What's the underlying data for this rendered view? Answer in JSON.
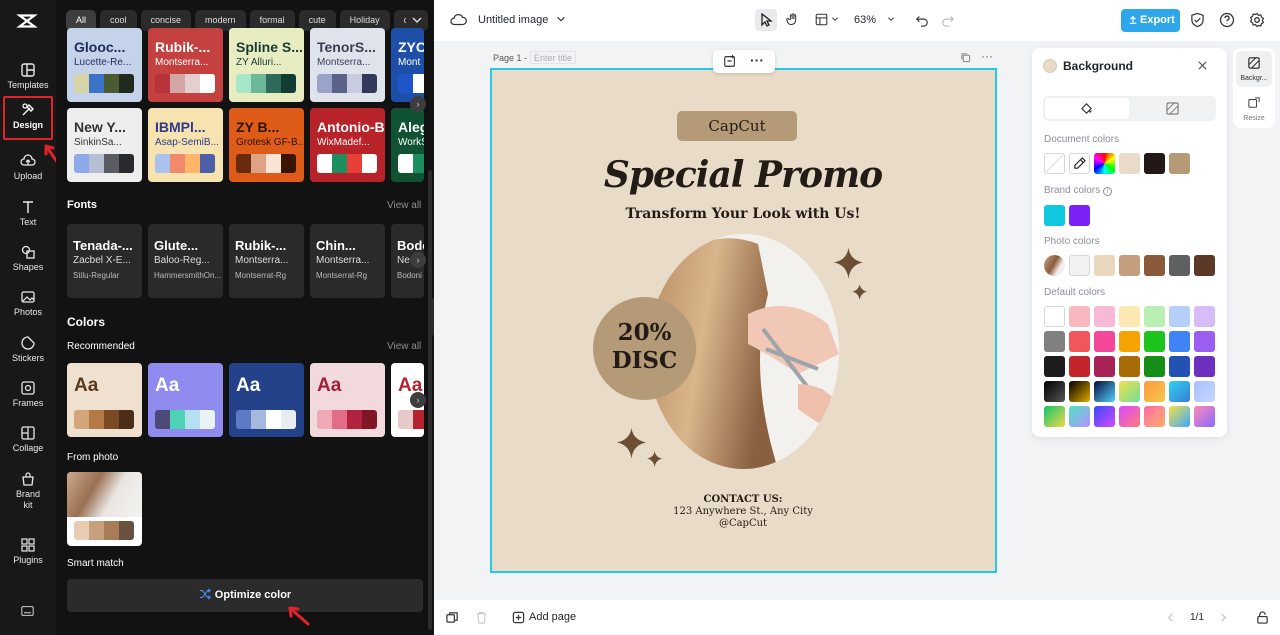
{
  "rail": {
    "items": [
      {
        "label": "Templates"
      },
      {
        "label": "Design"
      },
      {
        "label": "Upload"
      },
      {
        "label": "Text"
      },
      {
        "label": "Shapes"
      },
      {
        "label": "Photos"
      },
      {
        "label": "Stickers"
      },
      {
        "label": "Frames"
      },
      {
        "label": "Collage"
      },
      {
        "label": "Brand kit"
      },
      {
        "label": "Plugins"
      }
    ]
  },
  "chips": [
    "All",
    "cool",
    "concise",
    "modern",
    "formal",
    "cute",
    "Holiday",
    "clas"
  ],
  "font_pairs": [
    {
      "f1": "Glooc...",
      "f2": "Lucette-Re...",
      "bg": "#c5d3ea",
      "color": "#1c2d5a"
    },
    {
      "f1": "Rubik-...",
      "f2": "Montserra...",
      "bg": "#c5413f",
      "color": "#ffffff"
    },
    {
      "f1": "Spline S...",
      "f2": "ZY Alluri...",
      "bg": "#e8ecc1",
      "color": "#173b33"
    },
    {
      "f1": "TenorS...",
      "f2": "Montserra...",
      "bg": "#dfe3ec",
      "color": "#3a3f55"
    },
    {
      "f1": "ZYC",
      "f2": "Mont",
      "bg": "#1e4fa8",
      "color": "#ffffff"
    },
    {
      "f1": "New Y...",
      "f2": "SinkinSa...",
      "bg": "#eeeeee",
      "color": "#333333"
    },
    {
      "f1": "IBMPl...",
      "f2": "Asap-SemiB...",
      "bg": "#f6e3b0",
      "color": "#2f3a8a"
    },
    {
      "f1": "ZY B...",
      "f2": "Grotesk GF-B...",
      "bg": "#de5b18",
      "color": "#2a1406"
    },
    {
      "f1": "Antonio-Bold",
      "f2": "WixMadef...",
      "bg": "#b8232a",
      "color": "#ffffff"
    },
    {
      "f1": "Alegr",
      "f2": "WorkS",
      "bg": "#0f5332",
      "color": "#ffffff"
    }
  ],
  "sections": {
    "fonts": "Fonts",
    "colors": "Colors",
    "recommended": "Recommended",
    "from_photo": "From photo",
    "smart_match": "Smart match",
    "view_all": "View all"
  },
  "fonts": [
    {
      "t1": "Tenada-...",
      "t2": "Zacbel X-E...",
      "t3": "Stilu-Regular"
    },
    {
      "t1": "Glute...",
      "t2": "Baloo-Reg...",
      "t3": "HammersmithOn..."
    },
    {
      "t1": "Rubik-...",
      "t2": "Montserra...",
      "t3": "Montserrat-Rg"
    },
    {
      "t1": "Chin...",
      "t2": "Montserra...",
      "t3": "Montserrat-Rg"
    },
    {
      "t1": "Bodoi",
      "t2": "Ne",
      "t3": "Bodoni M"
    }
  ],
  "recommended": [
    {
      "aa": "Aa",
      "bg": "#f0e0cf",
      "color": "#5a3a1f"
    },
    {
      "aa": "Aa",
      "bg": "#8f8bef",
      "color": "#ffffff"
    },
    {
      "aa": "Aa",
      "bg": "#23428a",
      "color": "#ffffff"
    },
    {
      "aa": "Aa",
      "bg": "#f1d9dd",
      "color": "#a12237"
    },
    {
      "aa": "Aa",
      "bg": "#ffffff",
      "color": "#b5242e"
    }
  ],
  "optimize_label": "Optimize color",
  "toolbar": {
    "title": "Untitled image",
    "zoom": "63%",
    "export": "Export"
  },
  "page": {
    "label": "Page 1 -",
    "title_placeholder": "Enter title"
  },
  "design": {
    "capcut": "CapCut",
    "promo": "Special Promo",
    "subtitle": "Transform Your Look with Us!",
    "disc_line1": "20%",
    "disc_line2": "DISC",
    "contact_title": "CONTACT US:",
    "contact_address": "123 Anywhere St., Any City",
    "contact_handle": "@CapCut"
  },
  "bg_panel": {
    "title": "Background",
    "document_colors": "Document colors",
    "brand_colors": "Brand colors",
    "photo_colors": "Photo colors",
    "default_colors": "Default colors",
    "doc_swatches": [
      "#e8dbc8",
      "#221816",
      "#b49a76"
    ],
    "brand_swatches": [
      "#0fc8e0",
      "#7a22f5"
    ],
    "photo_swatches": [
      "#f2f1ef",
      "#ead6bd",
      "#c49e7e",
      "#8b5a3a",
      "#5e6062",
      "#5a3a25"
    ],
    "default_grid": [
      [
        "#ffffff",
        "#f7b8bf",
        "#f8b9d7",
        "#fde7b2",
        "#b9efb3",
        "#b6cffb",
        "#d7bdf8"
      ],
      [
        "#808080",
        "#f0565a",
        "#f3479a",
        "#f6a404",
        "#1ec41e",
        "#3e84f5",
        "#9a5ff0"
      ],
      [
        "#1c1c1c",
        "#c3262a",
        "#a72256",
        "#a86c06",
        "#168d16",
        "#2452b4",
        "#6d2fbd"
      ]
    ]
  },
  "side_tabs": {
    "background": "Backgr...",
    "resize": "Resize"
  },
  "bottom": {
    "add_page": "Add page",
    "page_counter": "1/1"
  }
}
